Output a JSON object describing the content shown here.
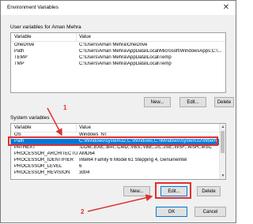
{
  "window": {
    "title": "Environment Variables",
    "close_glyph": "✕"
  },
  "user_section": {
    "label": "User variables for Aman Mehra",
    "columns": [
      "Variable",
      "Value"
    ],
    "rows": [
      {
        "variable": "OneDrive",
        "value": "C:\\Users\\Aman Mehra\\OneDrive"
      },
      {
        "variable": "Path",
        "value": "C:\\Users\\Aman Mehra\\AppData\\Local\\Microsoft\\WindowsApps;C:\\..."
      },
      {
        "variable": "TEMP",
        "value": "C:\\Users\\Aman Mehra\\AppData\\Local\\Temp"
      },
      {
        "variable": "TMP",
        "value": "C:\\Users\\Aman Mehra\\AppData\\Local\\Temp"
      }
    ],
    "buttons": {
      "new": "New...",
      "edit": "Edit...",
      "delete": "Delete"
    }
  },
  "system_section": {
    "label": "System variables",
    "columns": [
      "Variable",
      "Value"
    ],
    "rows": [
      {
        "variable": "OS",
        "value": "Windows_NT"
      },
      {
        "variable": "Path",
        "value": "C:\\Windows\\system32;C:\\Windows;C:\\Windows\\System32\\Wbem;...",
        "selected": true
      },
      {
        "variable": "PATHEXT",
        "value": ".COM;.EXE;.BAT;.CMD;.VBS;.VBE;.JS;.JSE;.WSF;.WSH;.MSC"
      },
      {
        "variable": "PROCESSOR_ARCHITECTURE",
        "value": "AMD64"
      },
      {
        "variable": "PROCESSOR_IDENTIFIER",
        "value": "Intel64 Family 6 Model 61 Stepping 4, GenuineIntel"
      },
      {
        "variable": "PROCESSOR_LEVEL",
        "value": "6"
      },
      {
        "variable": "PROCESSOR_REVISION",
        "value": "3d04"
      }
    ],
    "buttons": {
      "new": "New...",
      "edit": "Edit...",
      "delete": "Delete"
    }
  },
  "footer": {
    "ok": "OK",
    "cancel": "Cancel"
  },
  "annotations": {
    "step1": "1",
    "step2": "2",
    "color": "#e0302f"
  }
}
